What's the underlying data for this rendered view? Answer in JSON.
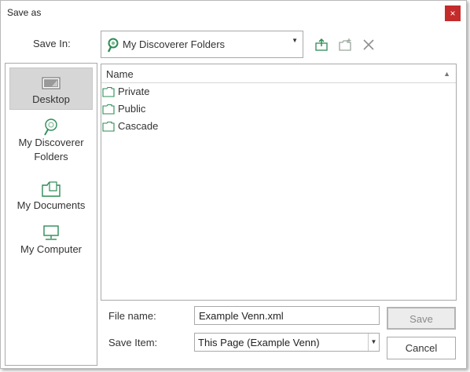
{
  "window": {
    "title": "Save as",
    "close_glyph": "×"
  },
  "save_in": {
    "label": "Save In:",
    "value": "My Discoverer Folders",
    "icon": "discoverer-folders-icon"
  },
  "toolbar": {
    "buttons": [
      {
        "name": "up-one-level-icon"
      },
      {
        "name": "new-folder-icon"
      },
      {
        "name": "delete-icon"
      }
    ]
  },
  "places": [
    {
      "label": "Desktop",
      "icon": "desktop-icon",
      "selected": true
    },
    {
      "label": "My Discoverer\nFolders",
      "icon": "discoverer-folders-icon",
      "selected": false
    },
    {
      "label": "My Documents",
      "icon": "my-documents-icon",
      "selected": false
    },
    {
      "label": "My Computer",
      "icon": "computer-icon",
      "selected": false
    }
  ],
  "file_list": {
    "column_header": "Name",
    "sort": "ascending",
    "rows": [
      {
        "name": "Private",
        "type": "folder"
      },
      {
        "name": "Public",
        "type": "folder"
      },
      {
        "name": "Cascade",
        "type": "folder"
      }
    ]
  },
  "form": {
    "file_name_label": "File name:",
    "file_name_value": "Example Venn.xml",
    "save_item_label": "Save Item:",
    "save_item_value": "This Page (Example Venn)"
  },
  "buttons": {
    "save": "Save",
    "cancel": "Cancel"
  },
  "colors": {
    "accent_green": "#2e8b57",
    "close_red": "#c42b2b",
    "disabled_text": "#8a8a8a"
  }
}
